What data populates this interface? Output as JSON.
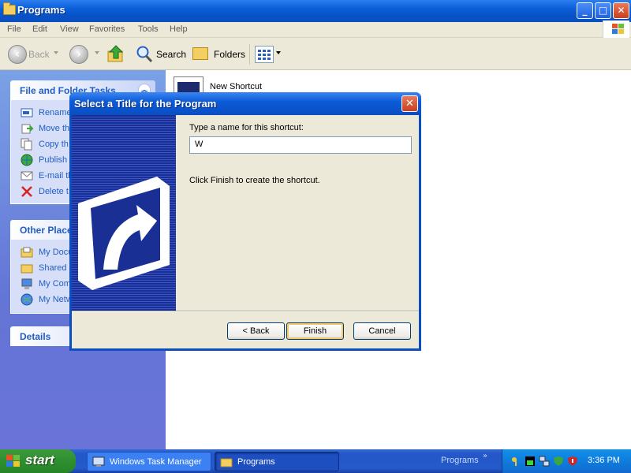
{
  "window": {
    "title": "Programs",
    "controls": {
      "minimize": "_",
      "maximize": "□",
      "close": "✕"
    }
  },
  "menubar": [
    "File",
    "Edit",
    "View",
    "Favorites",
    "Tools",
    "Help"
  ],
  "toolbar": {
    "back_label": "Back",
    "search_label": "Search",
    "folders_label": "Folders"
  },
  "taskpane": {
    "file_tasks": {
      "title": "File and Folder Tasks",
      "items": [
        "Rename",
        "Move th",
        "Copy th",
        "Publish t",
        "E-mail th",
        "Delete t"
      ]
    },
    "other_places": {
      "title": "Other Place",
      "items": [
        "My Docu",
        "Shared D",
        "My Comp",
        "My Netw"
      ]
    },
    "details": {
      "title": "Details"
    }
  },
  "files": [
    {
      "name": "New Shortcut",
      "type": "File"
    }
  ],
  "dialog": {
    "title": "Select a Title for the Program",
    "prompt": "Type a name for this shortcut:",
    "name_value": "W",
    "finish_hint": "Click Finish to create the shortcut.",
    "buttons": {
      "back": "< Back",
      "finish": "Finish",
      "cancel": "Cancel"
    }
  },
  "taskbar": {
    "start_label": "start",
    "tasks": [
      "Windows Task Manager",
      "Programs"
    ],
    "quick_label": "Programs",
    "chevron": "»",
    "clock": "3:36 PM"
  },
  "colors": {
    "title_blue": "#0a5fd8",
    "taskpane_link": "#215dc6",
    "start_green": "#2f8f2f",
    "wizard_blue": "#1a2f94"
  }
}
